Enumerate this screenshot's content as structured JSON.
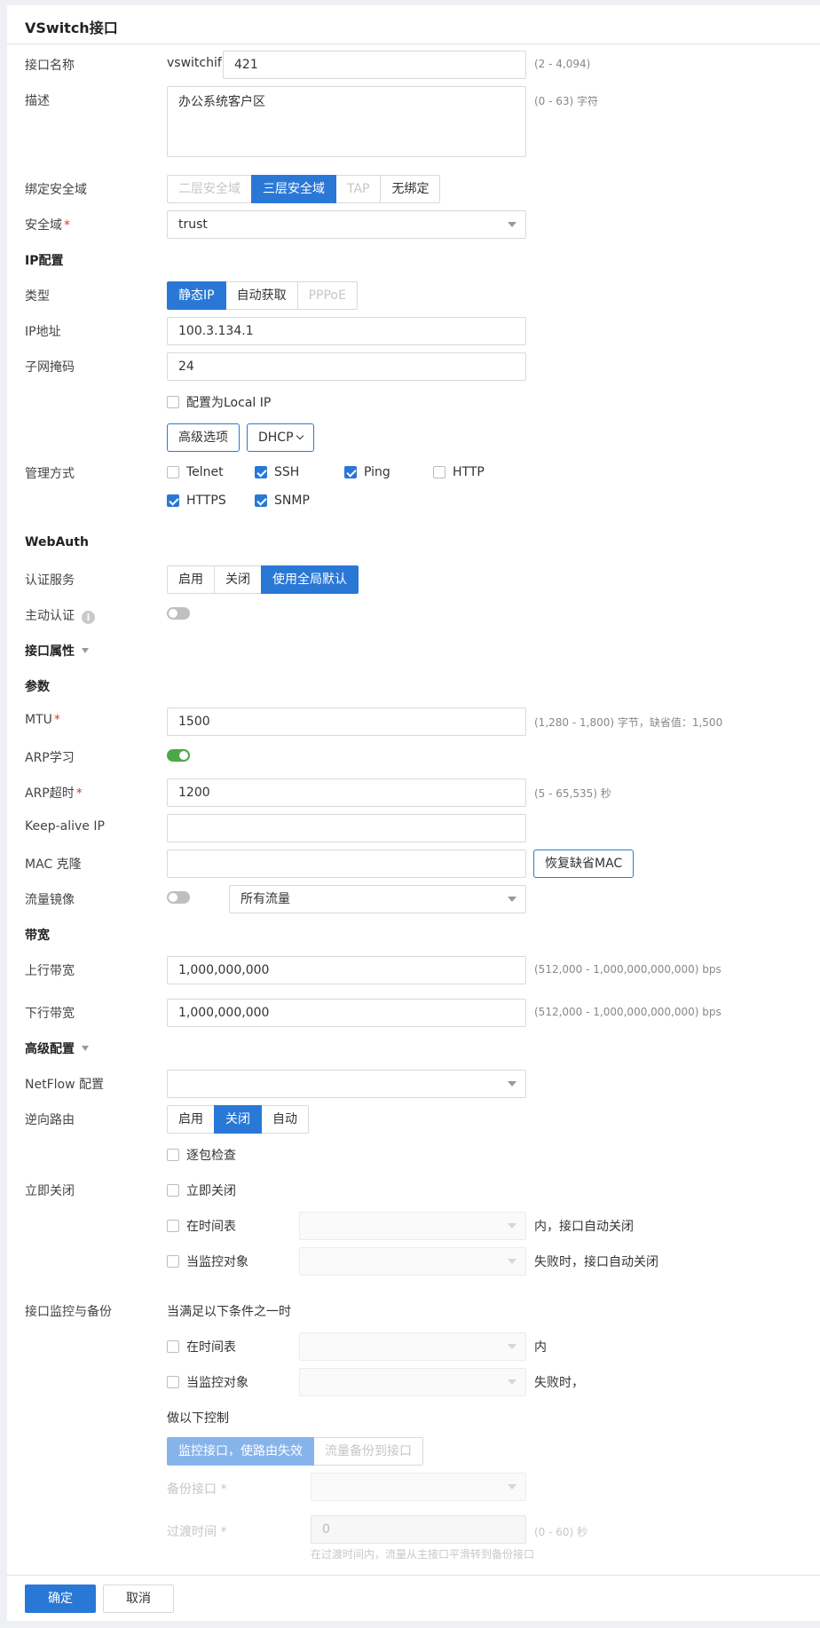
{
  "window": {
    "title": "VSwitch接口"
  },
  "interface_name": {
    "label": "接口名称",
    "prefix": "vswitchif",
    "value": "421",
    "hint": "(2 - 4,094)"
  },
  "description": {
    "label": "描述",
    "value": "办公系统客户区",
    "hint": "(0 - 63) 字符"
  },
  "bind_zone": {
    "label": "绑定安全域",
    "options": [
      "二层安全域",
      "三层安全域",
      "TAP",
      "无绑定"
    ],
    "selected": "三层安全域"
  },
  "security_zone": {
    "label": "安全域",
    "required_mark": "*",
    "value": "trust"
  },
  "ip_config": {
    "section": "IP配置",
    "type_label": "类型",
    "type_options": [
      "静态IP",
      "自动获取",
      "PPPoE"
    ],
    "type_selected": "静态IP",
    "ip_label": "IP地址",
    "ip_value": "100.3.134.1",
    "mask_label": "子网掩码",
    "mask_value": "24",
    "local_ip_label": "配置为Local IP",
    "local_ip_checked": false,
    "advanced_button": "高级选项",
    "dhcp_button": "DHCP"
  },
  "management": {
    "label": "管理方式",
    "items": [
      {
        "name": "Telnet",
        "checked": false
      },
      {
        "name": "SSH",
        "checked": true
      },
      {
        "name": "Ping",
        "checked": true
      },
      {
        "name": "HTTP",
        "checked": false
      },
      {
        "name": "HTTPS",
        "checked": true
      },
      {
        "name": "SNMP",
        "checked": true
      }
    ]
  },
  "webauth": {
    "section": "WebAuth",
    "service_label": "认证服务",
    "service_options": [
      "启用",
      "关闭",
      "使用全局默认"
    ],
    "service_selected": "使用全局默认",
    "active_auth_label": "主动认证",
    "active_auth_on": false
  },
  "interface_attr": {
    "section": "接口属性"
  },
  "params": {
    "section": "参数",
    "mtu_label": "MTU",
    "mtu_required": "*",
    "mtu_value": "1500",
    "mtu_hint": "(1,280 - 1,800) 字节，缺省值：1,500",
    "arp_learn_label": "ARP学习",
    "arp_learn_on": true,
    "arp_timeout_label": "ARP超时",
    "arp_timeout_required": "*",
    "arp_timeout_value": "1200",
    "arp_timeout_hint": "(5 - 65,535) 秒",
    "keepalive_label": "Keep-alive IP",
    "keepalive_value": "",
    "mac_clone_label": "MAC 克隆",
    "mac_clone_value": "",
    "restore_mac_button": "恢复缺省MAC",
    "mirror_label": "流量镜像",
    "mirror_on": false,
    "mirror_select": "所有流量"
  },
  "bandwidth": {
    "section": "带宽",
    "up_label": "上行带宽",
    "up_value": "1,000,000,000",
    "up_hint": "(512,000 - 1,000,000,000,000) bps",
    "down_label": "下行带宽",
    "down_value": "1,000,000,000",
    "down_hint": "(512,000 - 1,000,000,000,000) bps"
  },
  "advanced": {
    "section": "高级配置",
    "netflow_label": "NetFlow 配置",
    "netflow_value": "",
    "reverse_route_label": "逆向路由",
    "reverse_route_options": [
      "启用",
      "关闭",
      "自动"
    ],
    "reverse_route_selected": "关闭",
    "per_packet_label": "逐包检查",
    "per_packet_checked": false
  },
  "shutdown": {
    "label": "立即关闭",
    "immediate_label": "立即关闭",
    "schedule_label": "在时间表",
    "schedule_suffix": "内，接口自动关闭",
    "monitor_label": "当监控对象",
    "monitor_suffix": "失败时，接口自动关闭"
  },
  "monitor_backup": {
    "label": "接口监控与备份",
    "condition_text": "当满足以下条件之一时",
    "schedule_label": "在时间表",
    "schedule_suffix": "内",
    "monitor_label": "当监控对象",
    "monitor_suffix": "失败时，",
    "action_text": "做以下控制",
    "action_options": [
      "监控接口，使路由失效",
      "流量备份到接口"
    ],
    "action_selected": "监控接口，使路由失效",
    "backup_label": "备份接口",
    "backup_required": "*",
    "transition_label": "过渡时间",
    "transition_required": "*",
    "transition_value": "0",
    "transition_hint": "(0 - 60) 秒",
    "transition_note": "在过渡时间内，流量从主接口平滑转到备份接口"
  },
  "footer": {
    "ok": "确定",
    "cancel": "取消"
  },
  "colors": {
    "primary": "#2a78d6",
    "toggle_on": "#4aa846",
    "required": "#e0392b"
  }
}
